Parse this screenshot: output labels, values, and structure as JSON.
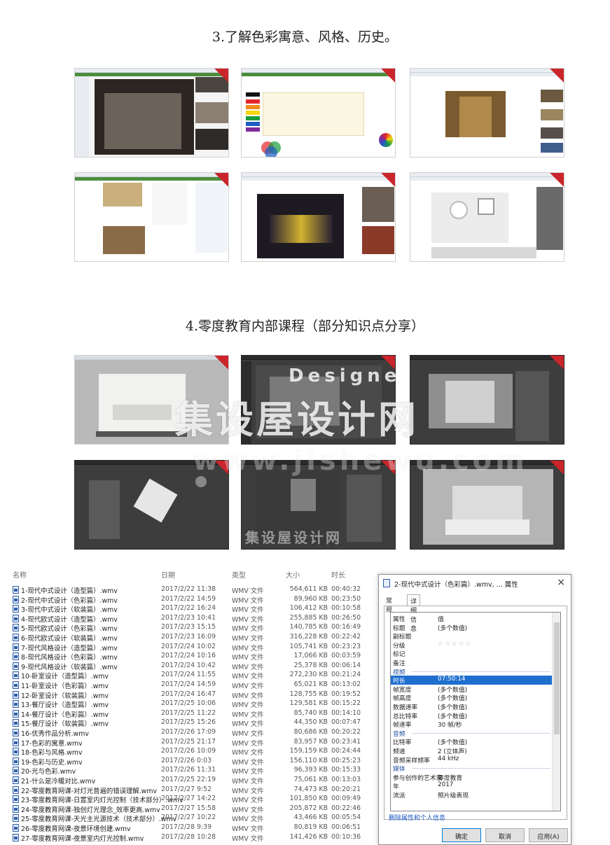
{
  "section1_title": "3.了解色彩寓意、风格、历史。",
  "section2_title": "4.零度教育内部课程（部分知识点分享）",
  "watermark": {
    "main": "集设屋设计网",
    "designer": "Designer",
    "url": "www.jishewu.com",
    "small": "集设屋设计网"
  },
  "file_list": {
    "columns": {
      "name": "名称",
      "date": "日期",
      "type": "类型",
      "size": "大小",
      "length": "时长"
    },
    "rows": [
      {
        "name": "1-现代中式设计（造型篇）.wmv",
        "date": "2017/2/22 11:38",
        "type": "WMV 文件",
        "size": "564,611 KB",
        "length": "00:40:32"
      },
      {
        "name": "2-现代中式设计（色彩篇）.wmv",
        "date": "2017/2/22 14:59",
        "type": "WMV 文件",
        "size": "89,960 KB",
        "length": "00:23:50"
      },
      {
        "name": "3-现代中式设计（软装篇）.wmv",
        "date": "2017/2/22 16:24",
        "type": "WMV 文件",
        "size": "106,412 KB",
        "length": "00:10:58"
      },
      {
        "name": "4-现代欧式设计（造型篇）.wmv",
        "date": "2017/2/23 10:41",
        "type": "WMV 文件",
        "size": "255,885 KB",
        "length": "00:26:50"
      },
      {
        "name": "5-现代欧式设计（色彩篇）.wmv",
        "date": "2017/2/23 15:15",
        "type": "WMV 文件",
        "size": "140,785 KB",
        "length": "00:16:49"
      },
      {
        "name": "6-现代欧式设计（软装篇）.wmv",
        "date": "2017/2/23 16:09",
        "type": "WMV 文件",
        "size": "316,228 KB",
        "length": "00:22:42"
      },
      {
        "name": "7-现代风格设计（造型篇）.wmv",
        "date": "2017/2/24 10:02",
        "type": "WMV 文件",
        "size": "105,741 KB",
        "length": "00:23:23"
      },
      {
        "name": "8-现代风格设计（色彩篇）.wmv",
        "date": "2017/2/24 10:16",
        "type": "WMV 文件",
        "size": "17,066 KB",
        "length": "00:03:59"
      },
      {
        "name": "9-现代风格设计（软装篇）.wmv",
        "date": "2017/2/24 10:42",
        "type": "WMV 文件",
        "size": "25,378 KB",
        "length": "00:06:14"
      },
      {
        "name": "10-卧室设计（造型篇）.wmv",
        "date": "2017/2/24 11:55",
        "type": "WMV 文件",
        "size": "272,230 KB",
        "length": "00:21:24"
      },
      {
        "name": "11-卧室设计（色彩篇）.wmv",
        "date": "2017/2/24 14:59",
        "type": "WMV 文件",
        "size": "65,021 KB",
        "length": "00:13:02"
      },
      {
        "name": "12-卧室设计（软装篇）.wmv",
        "date": "2017/2/24 16:47",
        "type": "WMV 文件",
        "size": "128,755 KB",
        "length": "00:19:52"
      },
      {
        "name": "13-餐厅设计（造型篇）.wmv",
        "date": "2017/2/25 10:06",
        "type": "WMV 文件",
        "size": "129,581 KB",
        "length": "00:15:22"
      },
      {
        "name": "14-餐厅设计（色彩篇）.wmv",
        "date": "2017/2/25 11:22",
        "type": "WMV 文件",
        "size": "85,740 KB",
        "length": "00:14:10"
      },
      {
        "name": "15-餐厅设计（软装篇）.wmv",
        "date": "2017/2/25 15:26",
        "type": "WMV 文件",
        "size": "44,350 KB",
        "length": "00:07:47"
      },
      {
        "name": "16-优秀作品分析.wmv",
        "date": "2017/2/26 17:09",
        "type": "WMV 文件",
        "size": "80,686 KB",
        "length": "00:20:22"
      },
      {
        "name": "17-色彩的寓意.wmv",
        "date": "2017/2/25 21:17",
        "type": "WMV 文件",
        "size": "83,957 KB",
        "length": "00:23:41"
      },
      {
        "name": "18-色彩与风格.wmv",
        "date": "2017/2/26 10:09",
        "type": "WMV 文件",
        "size": "159,159 KB",
        "length": "00:24:44"
      },
      {
        "name": "19-色彩与历史.wmv",
        "date": "2017/2/26 0:03",
        "type": "WMV 文件",
        "size": "156,110 KB",
        "length": "00:25:23"
      },
      {
        "name": "20-光与色彩.wmv",
        "date": "2017/2/26 11:31",
        "type": "WMV 文件",
        "size": "96,393 KB",
        "length": "00:15:33"
      },
      {
        "name": "21-什么是冷暖对比.wmv",
        "date": "2017/2/25 22:19",
        "type": "WMV 文件",
        "size": "75,061 KB",
        "length": "00:13:03"
      },
      {
        "name": "22-零度教育网课-对灯光普遍的错误理解.wmv",
        "date": "2017/2/27 9:52",
        "type": "WMV 文件",
        "size": "74,473 KB",
        "length": "00:20:21"
      },
      {
        "name": "23-零度教育网课-日置室内灯光控制（技术部分）.wmv",
        "date": "2017/2/27 14:22",
        "type": "WMV 文件",
        "size": "101,850 KB",
        "length": "00:09:49"
      },
      {
        "name": "24-零度教育网课-独创灯光理念_效率更高.wmv",
        "date": "2017/2/27 15:58",
        "type": "WMV 文件",
        "size": "205,872 KB",
        "length": "00:22:46"
      },
      {
        "name": "25-零度教育网课-天光主光源技术（技术部分）.wmv",
        "date": "2017/2/27 10:22",
        "type": "WMV 文件",
        "size": "43,466 KB",
        "length": "00:05:54"
      },
      {
        "name": "26-零度教育网课-夜景环境创建.wmv",
        "date": "2017/2/28 9:39",
        "type": "WMV 文件",
        "size": "80,819 KB",
        "length": "00:06:51"
      },
      {
        "name": "27-零度教育网课-夜景室内灯光控制.wmv",
        "date": "2017/2/28 10:28",
        "type": "WMV 文件",
        "size": "141,426 KB",
        "length": "00:10:36"
      }
    ]
  },
  "properties": {
    "title": "2-现代中式设计（色彩篇）.wmv, ... 属性",
    "close": "×",
    "tabs": [
      "常规",
      "详细信息"
    ],
    "rows": [
      {
        "k": "属性",
        "v": "值"
      },
      {
        "k": "标题",
        "v": "(多个数值)"
      },
      {
        "k": "副标题",
        "v": ""
      },
      {
        "k": "分级",
        "v": "☆☆☆☆☆"
      },
      {
        "k": "标记",
        "v": ""
      },
      {
        "k": "备注",
        "v": ""
      },
      {
        "k": "视频",
        "v": "",
        "group": true
      },
      {
        "k": "时长",
        "v": "07:50:14",
        "sel": true
      },
      {
        "k": "帧宽度",
        "v": "(多个数值)"
      },
      {
        "k": "帧高度",
        "v": "(多个数值)"
      },
      {
        "k": "数据速率",
        "v": "(多个数值)"
      },
      {
        "k": "总比特率",
        "v": "(多个数值)"
      },
      {
        "k": "帧速率",
        "v": "30 帧/秒"
      },
      {
        "k": "音频",
        "v": "",
        "group": true
      },
      {
        "k": "比特率",
        "v": "(多个数值)"
      },
      {
        "k": "频道",
        "v": "2 (立体声)"
      },
      {
        "k": "音频采样频率",
        "v": "44 kHz"
      },
      {
        "k": "媒体",
        "v": "",
        "group": true
      },
      {
        "k": "参与创作的艺术家",
        "v": "零度教育"
      },
      {
        "k": "年",
        "v": "2017"
      },
      {
        "k": "流派",
        "v": "照片级表现"
      }
    ],
    "link": "删除属性和个人信息",
    "buttons": {
      "ok": "确定",
      "cancel": "取消",
      "apply": "应用(A)"
    }
  }
}
